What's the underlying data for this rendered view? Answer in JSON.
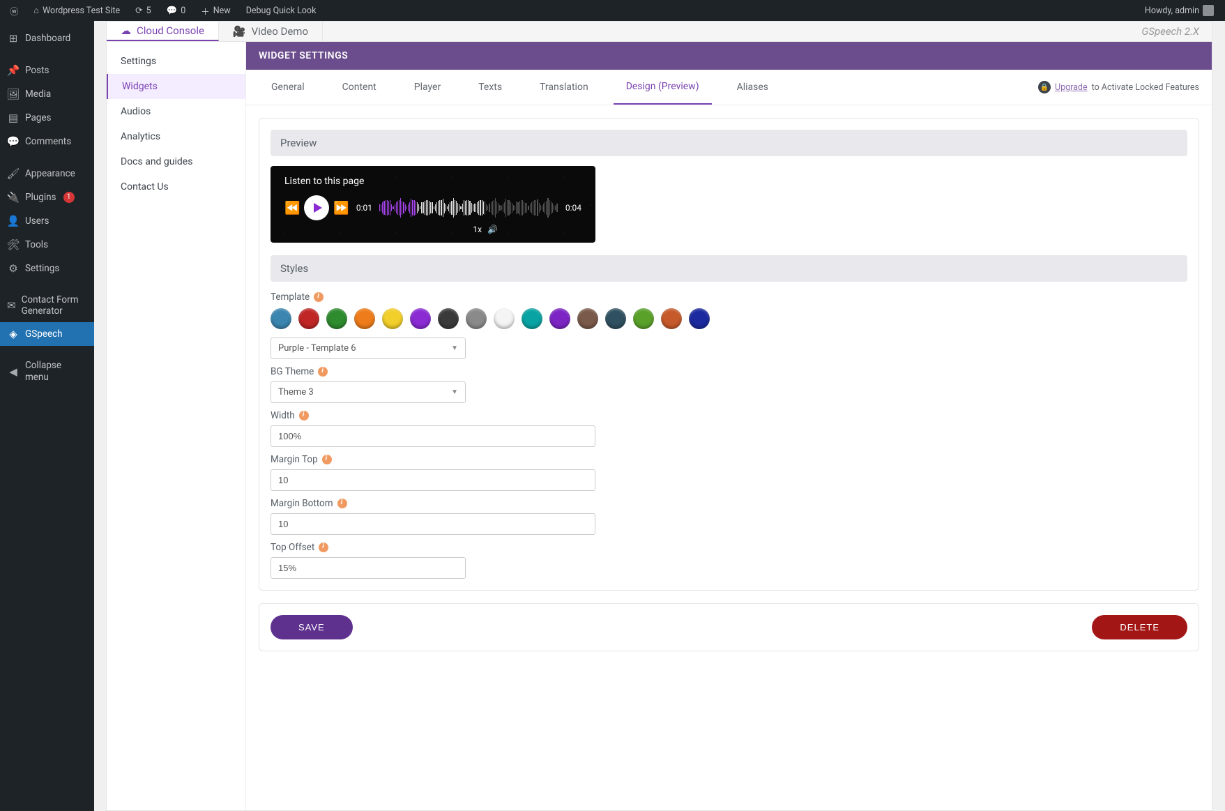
{
  "wpbar": {
    "site_name": "Wordpress Test Site",
    "refresh_count": "5",
    "comments_count": "0",
    "new_label": "New",
    "debug_label": "Debug Quick Look",
    "howdy": "Howdy, admin"
  },
  "wpsidebar": {
    "items": [
      {
        "icon": "⊞",
        "label": "Dashboard"
      },
      {
        "icon": "📌",
        "label": "Posts"
      },
      {
        "icon": "🖼",
        "label": "Media"
      },
      {
        "icon": "▤",
        "label": "Pages"
      },
      {
        "icon": "💬",
        "label": "Comments"
      },
      {
        "icon": "🖌",
        "label": "Appearance"
      },
      {
        "icon": "🔌",
        "label": "Plugins",
        "badge": "1"
      },
      {
        "icon": "👤",
        "label": "Users"
      },
      {
        "icon": "🛠",
        "label": "Tools"
      },
      {
        "icon": "⚙",
        "label": "Settings"
      },
      {
        "icon": "✉",
        "label": "Contact Form Generator"
      },
      {
        "icon": "◈",
        "label": "GSpeech",
        "active": true
      },
      {
        "icon": "◀",
        "label": "Collapse menu"
      }
    ]
  },
  "topstrip": {
    "cloud": "Cloud Console",
    "video": "Video Demo",
    "version": "GSpeech 2.X"
  },
  "gsmenu": {
    "items": [
      "Settings",
      "Widgets",
      "Audios",
      "Analytics",
      "Docs and guides",
      "Contact Us"
    ],
    "active_index": 1
  },
  "page": {
    "title": "WIDGET SETTINGS",
    "tabs": [
      "General",
      "Content",
      "Player",
      "Texts",
      "Translation",
      "Design (Preview)",
      "Aliases"
    ],
    "active_tab_index": 5,
    "upgrade_link": "Upgrade",
    "upgrade_suffix": " to Activate Locked Features"
  },
  "preview": {
    "section": "Preview",
    "listen": "Listen to this page",
    "t_start": "0:01",
    "t_end": "0:04",
    "speed": "1x"
  },
  "styles": {
    "section": "Styles",
    "template_label": "Template",
    "template_value": "Purple - Template 6",
    "colors": [
      "#3b86b0",
      "#c02626",
      "#2e8b2e",
      "#ef7c1a",
      "#f2cf2a",
      "#8a2bd4",
      "#3a3a3a",
      "#8a8a8a",
      "#f4f4f4",
      "#0aa3a3",
      "#7c25c4",
      "#7a5a4a",
      "#2f5060",
      "#5aa12a",
      "#c65a2a",
      "#1b2a9e"
    ],
    "bg_label": "BG Theme",
    "bg_value": "Theme 3",
    "width_label": "Width",
    "width_value": "100%",
    "mtop_label": "Margin Top",
    "mtop_value": "10",
    "mbottom_label": "Margin Bottom",
    "mbottom_value": "10",
    "topoffset_label": "Top Offset",
    "topoffset_value": "15%"
  },
  "buttons": {
    "save": "SAVE",
    "delete": "DELETE"
  }
}
